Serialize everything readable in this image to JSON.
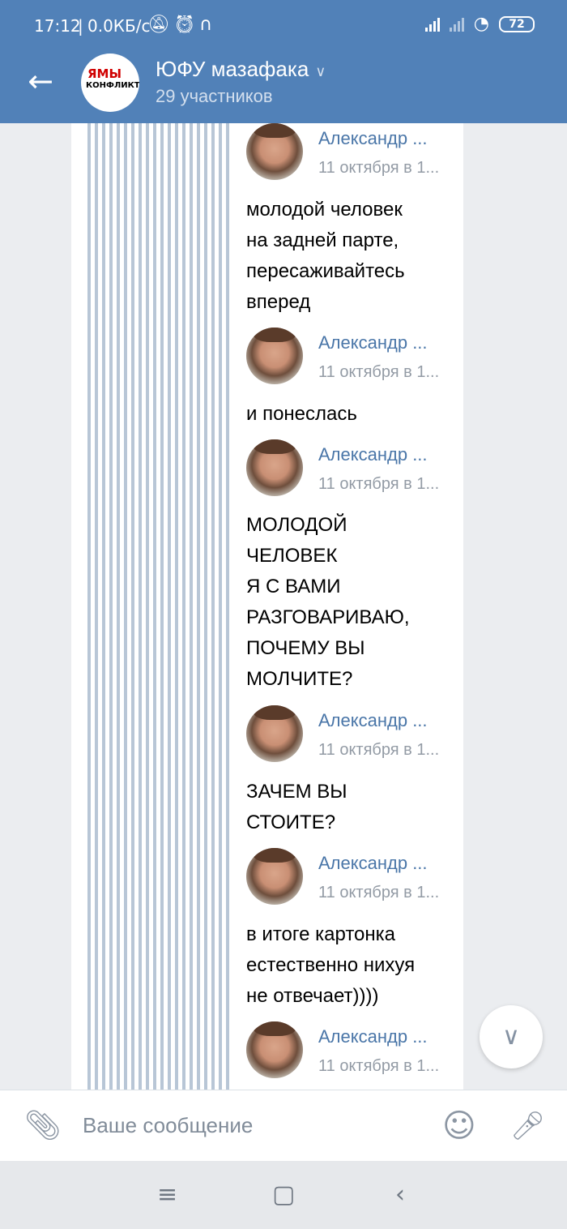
{
  "status_bar": {
    "time": "17:12",
    "net_speed": "0.0КБ/с",
    "battery": "72",
    "icons": [
      "mute-icon",
      "alarm-icon",
      "headphones-icon",
      "signal-icon",
      "signal-icon",
      "wifi-icon",
      "battery-icon"
    ]
  },
  "header": {
    "title": "ЮФУ мазафака",
    "subtitle": "29 участников",
    "avatar_logo_top": "ЯМЫ",
    "avatar_logo_bottom": "КОНФЛИКТО",
    "bg_color": "#5181b8"
  },
  "messages": [
    {
      "name": "Александр ...",
      "date": "11 октября в 1...",
      "text": "молодой человек\nна задней парте,\nпересаживайтесь\nвперед"
    },
    {
      "name": "Александр ...",
      "date": "11 октября в 1...",
      "text": "и понеслась"
    },
    {
      "name": "Александр ...",
      "date": "11 октября в 1...",
      "text": "МОЛОДОЙ\nЧЕЛОВЕК\nЯ С ВАМИ\nРАЗГОВАРИВАЮ,\nПОЧЕМУ ВЫ\nМОЛЧИТЕ?"
    },
    {
      "name": "Александр ...",
      "date": "11 октября в 1...",
      "text": "ЗАЧЕМ ВЫ\nСТОИТЕ?"
    },
    {
      "name": "Александр ...",
      "date": "11 октября в 1...",
      "text": "в итоге картонка\nестественно нихуя\nне отвечает))))"
    },
    {
      "name": "Александр ...",
      "date": "11 октября в 1...",
      "text": ""
    }
  ],
  "composer": {
    "placeholder": "Ваше сообщение"
  },
  "colors": {
    "link_blue": "#4a76a8",
    "date_gray": "#939ba5",
    "background": "#ebedf0"
  }
}
